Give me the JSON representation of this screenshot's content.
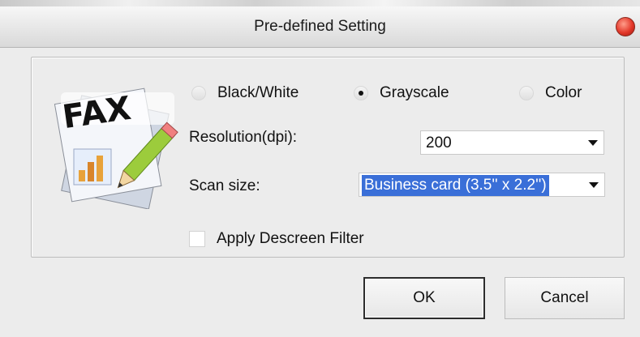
{
  "window": {
    "title": "Pre-defined Setting"
  },
  "icon": {
    "fax_text": "FAX"
  },
  "color_mode": {
    "options": [
      "Black/White",
      "Grayscale",
      "Color"
    ],
    "selected": "Grayscale"
  },
  "resolution": {
    "label": "Resolution(dpi):",
    "value": "200"
  },
  "scan_size": {
    "label": "Scan size:",
    "value": "Business card (3.5'' x 2.2'')"
  },
  "descreen": {
    "label": "Apply Descreen Filter",
    "checked": false
  },
  "buttons": {
    "ok": "OK",
    "cancel": "Cancel"
  },
  "colors": {
    "close": "#e3382a",
    "selection": "#3a6fd8"
  }
}
